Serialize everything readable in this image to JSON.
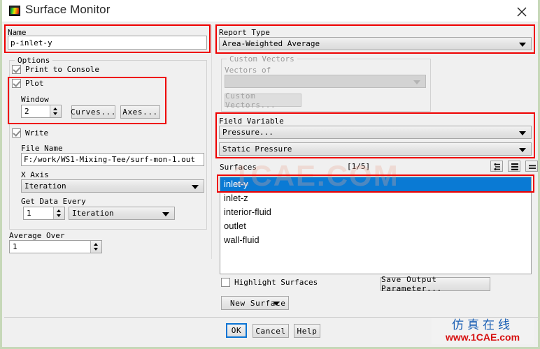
{
  "window": {
    "title": "Surface Monitor",
    "icon": "fluent-app-icon",
    "close_icon": "close-icon"
  },
  "left": {
    "name_group_label": "Name",
    "name_value": "p-inlet-y",
    "options_group_label": "Options",
    "print_to_console": {
      "label": "Print to Console",
      "checked": true
    },
    "plot": {
      "label": "Plot",
      "checked": true
    },
    "window_label": "Window",
    "window_value": "2",
    "curves_button": "Curves...",
    "axes_button": "Axes...",
    "write": {
      "label": "Write",
      "checked": true
    },
    "file_name_label": "File Name",
    "file_name_value": "F:/work/WS1-Mixing-Tee/surf-mon-1.out",
    "x_axis_label": "X Axis",
    "x_axis_value": "Iteration",
    "get_data_every_label": "Get Data Every",
    "get_data_every_value": "1",
    "get_data_every_unit": "Iteration",
    "average_over_label": "Average Over",
    "average_over_value": "1"
  },
  "right": {
    "report_type_label": "Report Type",
    "report_type_value": "Area-Weighted Average",
    "custom_vectors_group_label": "Custom Vectors",
    "vectors_of_label": "Vectors of",
    "vectors_of_value": "",
    "custom_vectors_button": "Custom Vectors...",
    "field_variable_label": "Field Variable",
    "field_variable_category": "Pressure...",
    "field_variable_value": "Static Pressure",
    "surfaces_label": "Surfaces",
    "surfaces_count": "[1/5]",
    "surface_tool_icons": [
      "filter-icon",
      "list-icon",
      "match-icon"
    ],
    "surfaces": [
      {
        "label": "inlet-y",
        "selected": true
      },
      {
        "label": "inlet-z",
        "selected": false
      },
      {
        "label": "interior-fluid",
        "selected": false
      },
      {
        "label": "outlet",
        "selected": false
      },
      {
        "label": "wall-fluid",
        "selected": false
      }
    ],
    "highlight_surfaces": {
      "label": "Highlight Surfaces",
      "checked": false
    },
    "save_output_parameter_button": "Save Output Parameter...",
    "new_surface_button": "New Surface"
  },
  "footer": {
    "ok_button": "OK",
    "cancel_button": "Cancel",
    "help_button": "Help"
  },
  "watermark": {
    "center_text": "1CAE.COM",
    "logo_cn": "仿真在线",
    "logo_en": "www.1CAE.com"
  },
  "colors": {
    "accent_selection": "#0a7ad4",
    "annotation": "#ee0000",
    "dialog_bg": "#f0f0f0",
    "window_border": "#c6d8b8"
  }
}
